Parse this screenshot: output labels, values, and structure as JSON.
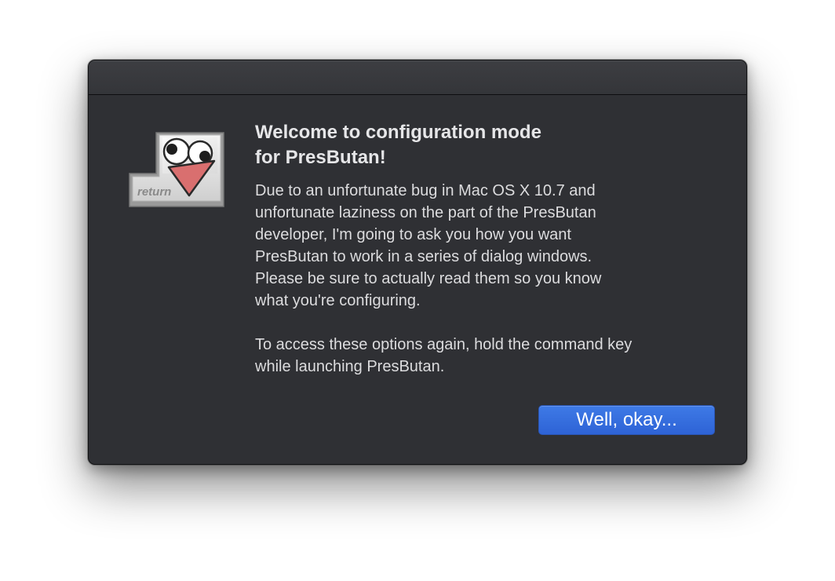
{
  "dialog": {
    "title": "Welcome to configuration mode\nfor PresButan!",
    "body_paragraph_1": "Due to an unfortunate bug in Mac OS X 10.7 and\nunfortunate laziness on the part of the PresButan\ndeveloper, I'm going to ask you how you want\nPresButan to work in a series of dialog windows.\nPlease be sure to actually read them so you know\nwhat you're configuring.",
    "body_paragraph_2": "To access these options again, hold the command key\nwhile launching PresButan.",
    "ok_button_label": "Well, okay..."
  },
  "app_icon": {
    "name": "presbutan-return-key-icon",
    "key_label": "return"
  },
  "colors": {
    "window_background": "#2f3034",
    "button_accent": "#3a72e0",
    "icon_tongue": "#d96f6f"
  }
}
